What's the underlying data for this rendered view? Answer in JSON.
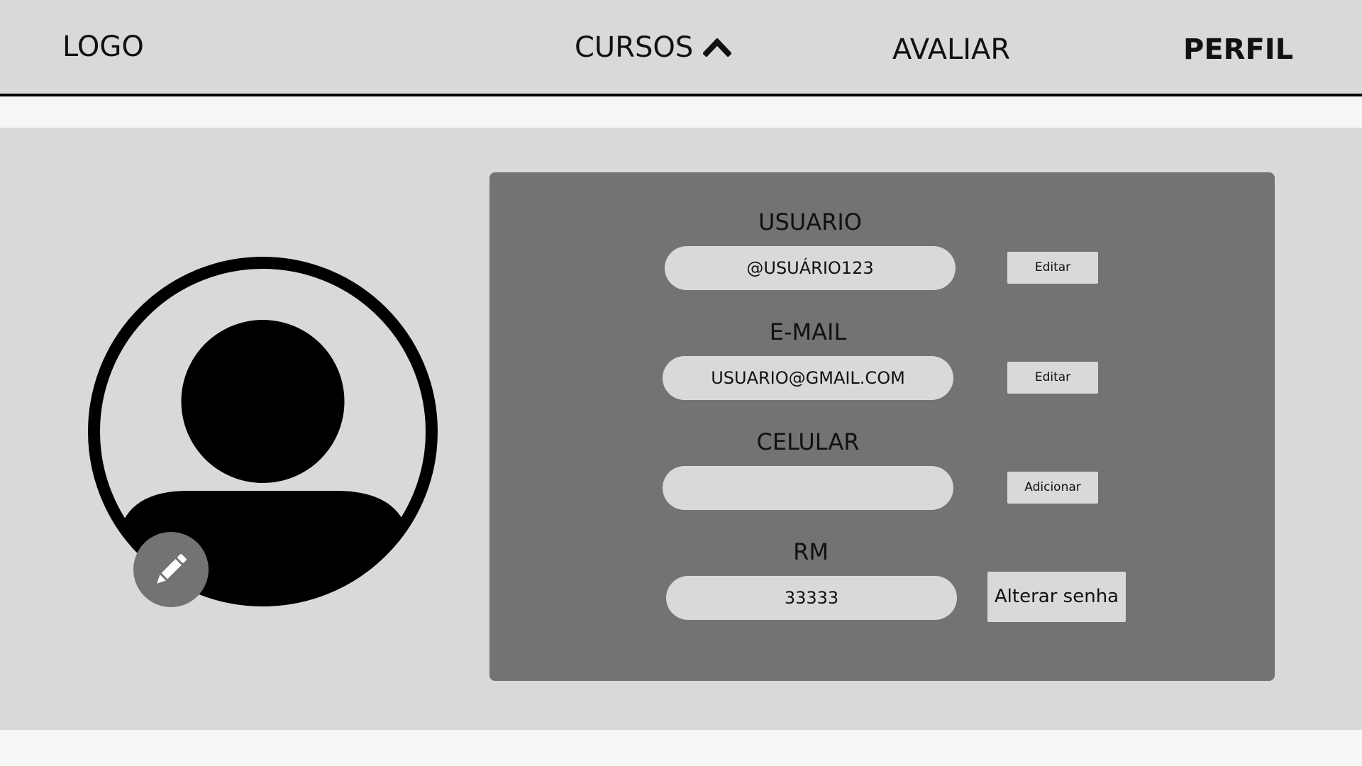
{
  "nav": {
    "logo": "LOGO",
    "cursos": "CURSOS",
    "avaliar": "AVALIAR",
    "perfil": "PERFIL"
  },
  "profile": {
    "usuario": {
      "label": "USUARIO",
      "value": "@USUÁRIO123",
      "button": "Editar"
    },
    "email": {
      "label": "E-MAIL",
      "value": "USUARIO@GMAIL.COM",
      "button": "Editar"
    },
    "celular": {
      "label": "CELULAR",
      "value": "",
      "button": "Adicionar"
    },
    "rm": {
      "label": "RM",
      "value": "33333",
      "button": "Alterar senha"
    }
  },
  "icons": {
    "cursos_toggle": "chevron-up-icon",
    "avatar": "user-silhouette-icon",
    "edit_avatar": "pencil-icon"
  },
  "colors": {
    "background": "#d9d9d9",
    "card": "#737373",
    "accent": "#000000"
  }
}
